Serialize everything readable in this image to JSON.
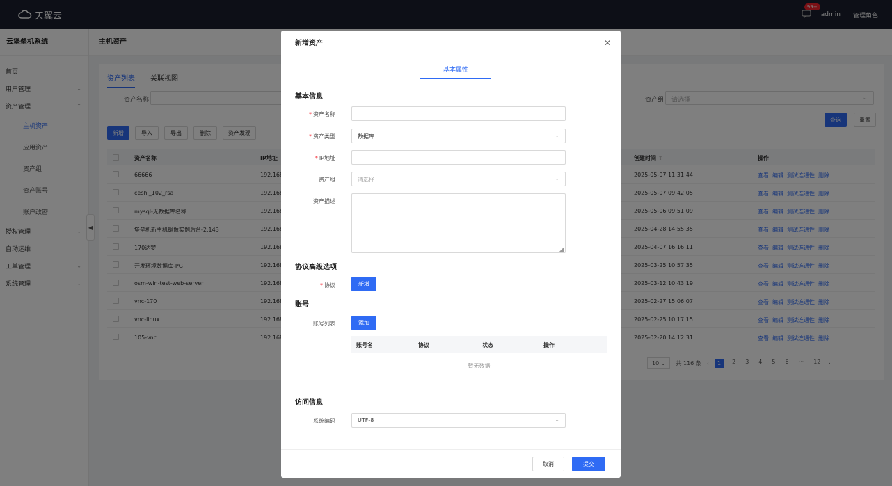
{
  "topbar": {
    "brand": "天翼云",
    "badge": "99+",
    "user": "admin",
    "role": "管理角色"
  },
  "sidebar": {
    "title": "云堡垒机系统",
    "items": [
      {
        "label": "首页",
        "chevron": ""
      },
      {
        "label": "用户管理",
        "chevron": "down"
      },
      {
        "label": "资产管理",
        "chevron": "up"
      }
    ],
    "subitems": [
      "主机资产",
      "应用资产",
      "资产组",
      "资产账号",
      "账户改密"
    ],
    "items2": [
      {
        "label": "授权管理",
        "chevron": "down"
      },
      {
        "label": "自动运维",
        "chevron": ""
      },
      {
        "label": "工单管理",
        "chevron": "down"
      },
      {
        "label": "系统管理",
        "chevron": "down"
      }
    ]
  },
  "page": {
    "title": "主机资产"
  },
  "tabs": [
    "资产列表",
    "关联视图"
  ],
  "filters": {
    "asset_name_label": "资产名称",
    "asset_group_label": "资产组",
    "asset_group_placeholder": "请选择",
    "query": "查询",
    "reset": "重置"
  },
  "toolbar": {
    "add": "新增",
    "import": "导入",
    "export": "导出",
    "delete": "删除",
    "discover": "资产发现"
  },
  "table": {
    "headers": {
      "name": "资产名称",
      "ip": "IP地址",
      "created": "创建时间",
      "sort": "⇕",
      "ops": "操作"
    },
    "ops": [
      "查看",
      "编辑",
      "测试连通性",
      "删除"
    ],
    "rows": [
      {
        "name": "66666",
        "ip": "192.168.",
        "created": "2025-05-07 11:31:44"
      },
      {
        "name": "ceshi_102_rsa",
        "ip": "192.168.",
        "created": "2025-05-07 09:42:05"
      },
      {
        "name": "mysql-无数据库名称",
        "ip": "192.168.",
        "created": "2025-05-06 09:51:09"
      },
      {
        "name": "堡垒机新主机镜像实例后台-2.143",
        "ip": "192.168.",
        "created": "2025-04-28 14:55:35"
      },
      {
        "name": "170达梦",
        "ip": "192.168.",
        "created": "2025-04-07 16:16:11"
      },
      {
        "name": "开发环境数据库-PG",
        "ip": "192.168.",
        "created": "2025-03-25 10:57:35"
      },
      {
        "name": "osm-win-test-web-server",
        "ip": "192.168.",
        "created": "2025-03-12 10:43:19"
      },
      {
        "name": "vnc-170",
        "ip": "192.168.",
        "created": "2025-02-27 15:06:07"
      },
      {
        "name": "vnc-linux",
        "ip": "192.168.",
        "created": "2025-02-25 10:17:15"
      },
      {
        "name": "105-vnc",
        "ip": "192.168.",
        "created": "2025-02-20 14:12:31"
      }
    ]
  },
  "pagination": {
    "page_size": "10",
    "total": "共 116 条",
    "pages": [
      "1",
      "2",
      "3",
      "4",
      "5",
      "6",
      "···",
      "12"
    ],
    "current": 1
  },
  "modal": {
    "title": "新增资产",
    "tab": "基本属性",
    "section_basic": "基本信息",
    "fields": {
      "name_label": "资产名称",
      "type_label": "资产类型",
      "type_value": "数据库",
      "ip_label": "IP地址",
      "group_label": "资产组",
      "group_placeholder": "请选择",
      "desc_label": "资产描述"
    },
    "section_protocol": "协议高级选项",
    "protocol_label": "协议",
    "protocol_add": "新增",
    "section_account": "账号",
    "account_list_label": "账号列表",
    "account_add": "添加",
    "account_headers": [
      "账号名",
      "协议",
      "状态",
      "操作"
    ],
    "empty": "暂无数据",
    "section_access": "访问信息",
    "encoding_label": "系统编码",
    "encoding_value": "UTF-8",
    "cancel": "取消",
    "submit": "提交"
  }
}
